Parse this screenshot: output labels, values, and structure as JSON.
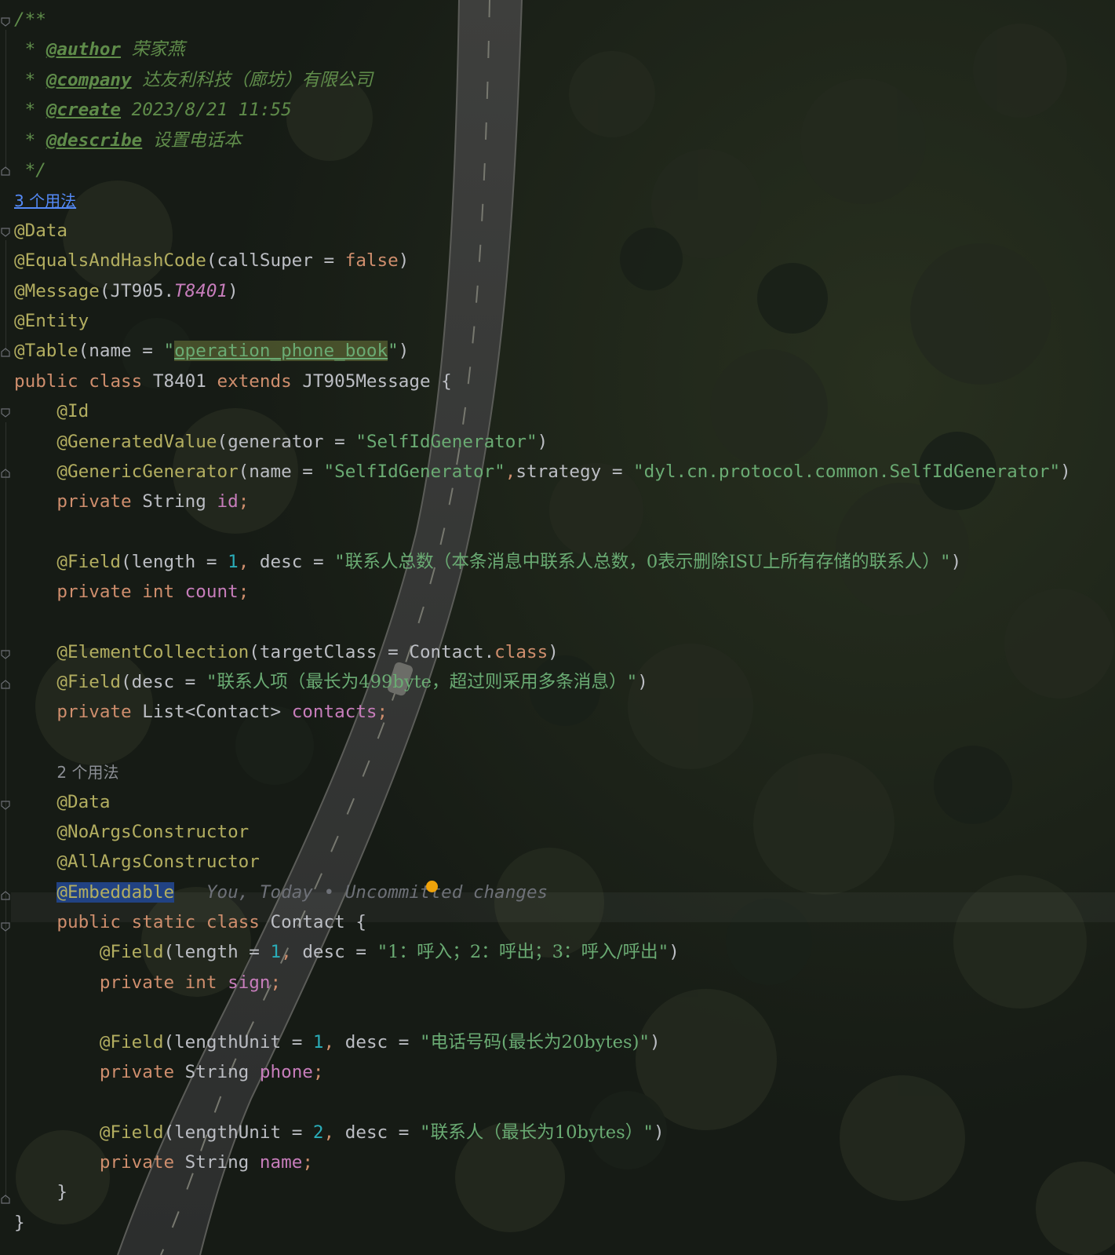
{
  "editor": {
    "javadoc": {
      "open": "/**",
      "author_tag": "@author",
      "author_value": "荣家燕",
      "company_tag": "@company",
      "company_value": "达友利科技（廊坊）有限公司",
      "create_tag": "@create",
      "create_value": "2023/8/21 11:55",
      "describe_tag": "@describe",
      "describe_value": "设置电话本",
      "close": "*/"
    },
    "usages_outer": "3 个用法",
    "usages_inner": "2 个用法",
    "class_annotations": {
      "data": "@Data",
      "equals": "@EqualsAndHashCode",
      "equals_param": "callSuper",
      "equals_value": "false",
      "message": "@Message",
      "message_class": "JT905",
      "message_const": "T8401",
      "entity": "@Entity",
      "table": "@Table",
      "table_param": "name",
      "table_value": "operation_phone_book"
    },
    "class_decl": {
      "mod1": "public",
      "mod2": "class",
      "name": "T8401",
      "extends_kw": "extends",
      "parent": "JT905Message"
    },
    "id_field": {
      "ann_id": "@Id",
      "ann_generated": "@GeneratedValue",
      "generator_param": "generator",
      "generator_value": "SelfIdGenerator",
      "ann_generic": "@GenericGenerator",
      "gen_name_param": "name",
      "gen_name_value": "SelfIdGenerator",
      "strategy_param": "strategy",
      "strategy_value": "dyl.cn.protocol.common.SelfIdGenerator",
      "modifier": "private",
      "type": "String",
      "name": "id"
    },
    "count_field": {
      "ann": "@Field",
      "length_param": "length",
      "length_value": "1",
      "desc_param": "desc",
      "desc_value": "联系人总数（本条消息中联系人总数，0表示删除ISU上所有存储的联系人）",
      "modifier": "private",
      "type": "int",
      "name": "count"
    },
    "contacts_field": {
      "ann_collection": "@ElementCollection",
      "target_param": "targetClass",
      "target_type": "Contact",
      "target_kw": "class",
      "ann_field": "@Field",
      "desc_param": "desc",
      "desc_value": "联系人项（最长为499byte，超过则采用多条消息）",
      "modifier": "private",
      "type": "List<Contact>",
      "name": "contacts"
    },
    "inner_class": {
      "ann_data": "@Data",
      "ann_noargs": "@NoArgsConstructor",
      "ann_allargs": "@AllArgsConstructor",
      "ann_embeddable": "@Embeddable",
      "blame": "You, Today • Uncommitted changes",
      "mod1": "public",
      "mod2": "static",
      "mod3": "class",
      "name": "Contact",
      "sign_ann": "@Field",
      "sign_len_param": "length",
      "sign_len_value": "1",
      "sign_desc_param": "desc",
      "sign_desc_value": "1：呼入；2：呼出；3：呼入/呼出",
      "sign_mod": "private",
      "sign_type": "int",
      "sign_name": "sign",
      "phone_ann": "@Field",
      "phone_len_param": "lengthUnit",
      "phone_len_value": "1",
      "phone_desc_param": "desc",
      "phone_desc_value": "电话号码(最长为20bytes)",
      "phone_mod": "private",
      "phone_type": "String",
      "phone_name": "phone",
      "name_ann": "@Field",
      "name_len_param": "lengthUnit",
      "name_len_value": "2",
      "name_desc_param": "desc",
      "name_desc_value": "联系人（最长为10bytes）",
      "name_mod": "private",
      "name_type": "String",
      "name_name": "name"
    }
  },
  "colors": {
    "keyword": "#cf8e6d",
    "annotation": "#b3ae60",
    "string": "#6aab73",
    "number": "#2aacb8",
    "field": "#c77dbb",
    "doc_comment": "#5f8c4a",
    "selection": "#214283",
    "vcs_marker": "#f0a30a"
  }
}
